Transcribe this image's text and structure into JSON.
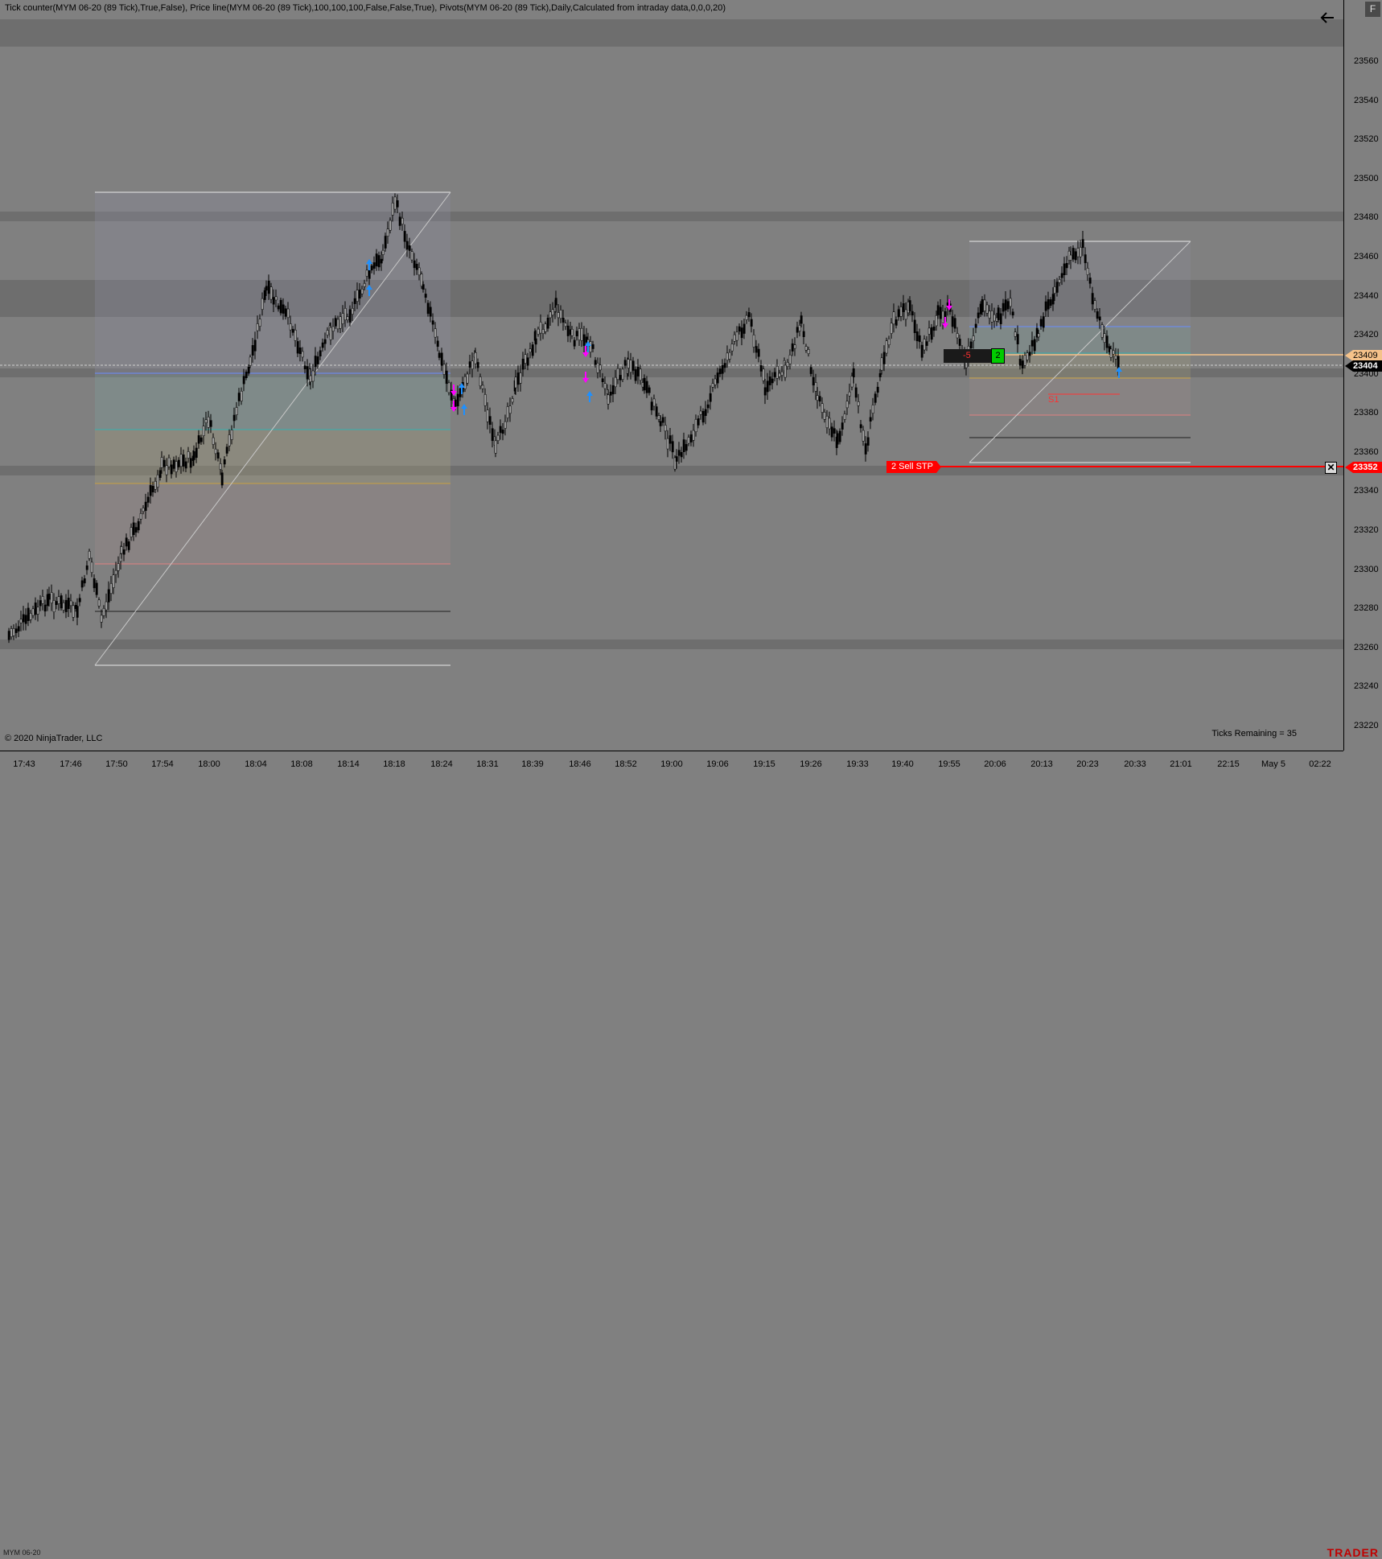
{
  "indicators_label": "Tick counter(MYM 06-20 (89 Tick),True,False), Price line(MYM 06-20 (89 Tick),100,100,100,False,False,True), Pivots(MYM 06-20 (89 Tick),Daily,Calculated from intraday data,0,0,0,20)",
  "copyright": "© 2020 NinjaTrader, LLC",
  "ticks_remaining": "Ticks Remaining = 35",
  "instrument_tab": "MYM 06-20",
  "logo_text": "TRADER",
  "f_button": "F",
  "back_icon": "arrow-left-icon",
  "y_ticks": [
    "23560",
    "23540",
    "23520",
    "23500",
    "23480",
    "23460",
    "23440",
    "23420",
    "23400",
    "23380",
    "23360",
    "23340",
    "23320",
    "23300",
    "23280",
    "23260",
    "23240",
    "23220"
  ],
  "x_ticks": [
    "17:43",
    "17:46",
    "17:50",
    "17:54",
    "18:00",
    "18:04",
    "18:08",
    "18:14",
    "18:18",
    "18:24",
    "18:31",
    "18:39",
    "18:46",
    "18:52",
    "19:00",
    "19:06",
    "19:15",
    "19:26",
    "19:33",
    "19:40",
    "19:55",
    "20:06",
    "20:13",
    "20:23",
    "20:33",
    "21:01",
    "22:15",
    "May 5",
    "02:22"
  ],
  "price_markers": {
    "ask": "23409",
    "last": "23404",
    "order": "23352"
  },
  "order": {
    "label": "2  Sell STP",
    "cancel": "✕"
  },
  "position": {
    "pnl": "-5",
    "qty": "2"
  },
  "pivot_label": "S1",
  "colors": {
    "background": "#808080",
    "band": "#6e6e6e",
    "order_line": "#ff0000",
    "ask_line": "#f5c28a",
    "candle": "#000000"
  }
}
